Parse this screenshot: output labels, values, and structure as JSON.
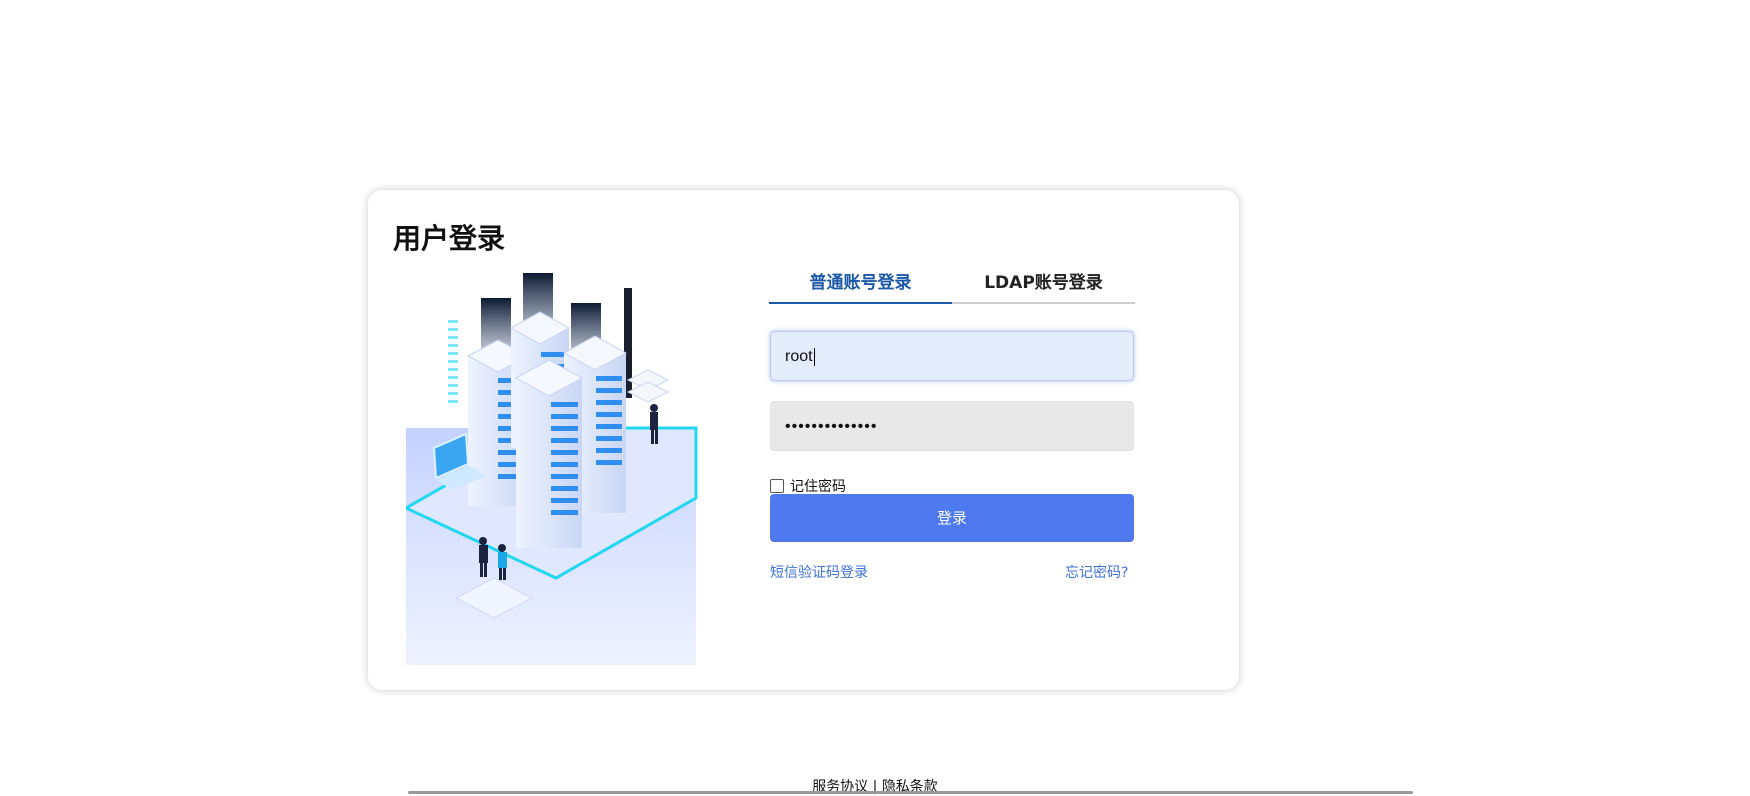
{
  "card": {
    "title": "用户登录"
  },
  "tabs": [
    {
      "label": "普通账号登录",
      "active": true
    },
    {
      "label": "LDAP账号登录",
      "active": false
    }
  ],
  "form": {
    "username_value": "root",
    "password_value": "••••••••••••••",
    "remember_label": "记住密码",
    "remember_checked": false,
    "submit_label": "登录"
  },
  "links": {
    "sms_login": "短信验证码登录",
    "forgot_password": "忘记密码?"
  },
  "footer": {
    "service_agreement": "服务协议",
    "separator": "|",
    "privacy_terms": "隐私条款"
  },
  "colors": {
    "accent": "#4f79ee",
    "active_tab": "#1c58a8",
    "link": "#3d72d6"
  },
  "icons": {
    "illustration": "server-datacenter-illustration"
  }
}
